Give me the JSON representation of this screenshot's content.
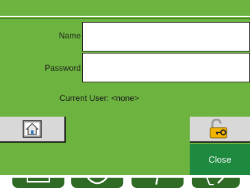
{
  "form": {
    "name_label": "Name",
    "password_label": "Password",
    "name_value": "",
    "password_value": ""
  },
  "status": {
    "current_user": "Current User: <none>"
  },
  "buttons": {
    "close_label": "Close",
    "home_icon": "home-icon",
    "lock_icon": "unlock-key-icon"
  },
  "colors": {
    "panel": "#6db33f",
    "close_button": "#1e8a3f"
  }
}
